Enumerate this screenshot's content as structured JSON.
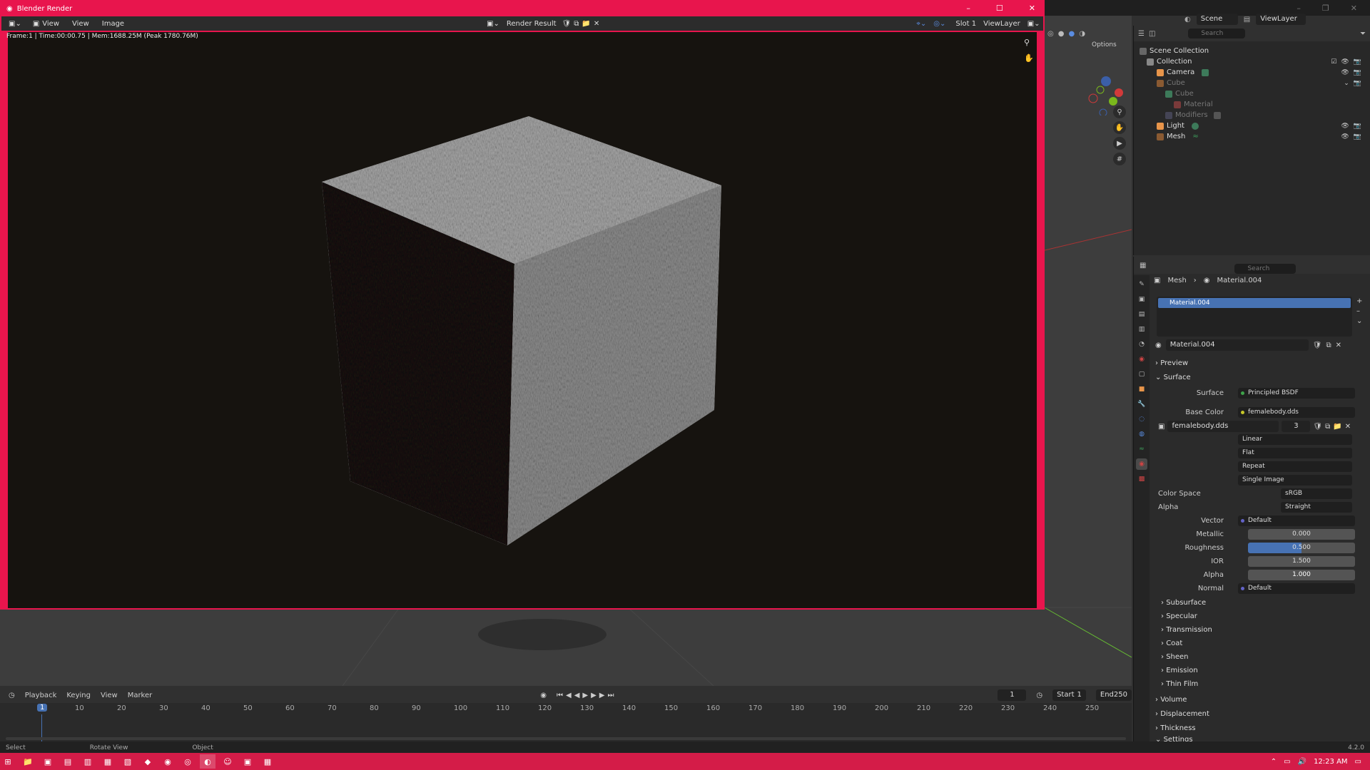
{
  "render_window": {
    "title": "Blender Render",
    "menu": {
      "view": "View",
      "view2": "View",
      "image": "Image"
    },
    "result_label": "Render Result",
    "slot": "Slot 1",
    "view_layer": "ViewLayer",
    "info": "Frame:1 | Time:00:00.75 | Mem:1688.25M (Peak 1780.76M)"
  },
  "scene_bar": {
    "scene": "Scene",
    "view_layer": "ViewLayer"
  },
  "viewport": {
    "options": "Options"
  },
  "outliner": {
    "search_placeholder": "Search",
    "items": [
      {
        "label": "Scene Collection"
      },
      {
        "label": "Collection"
      },
      {
        "label": "Camera"
      },
      {
        "label": "Cube"
      },
      {
        "label": "Cube"
      },
      {
        "label": "Material"
      },
      {
        "label": "Modifiers"
      },
      {
        "label": "Light"
      },
      {
        "label": "Mesh"
      }
    ]
  },
  "properties": {
    "search_placeholder": "Search",
    "breadcrumb_mesh": "Mesh",
    "breadcrumb_material": "Material.004",
    "slot_material": "Material.004",
    "material_name": "Material.004",
    "sections": {
      "preview": "Preview",
      "surface": "Surface"
    },
    "surface_label": "Surface",
    "surface_value": "Principled BSDF",
    "base_color_label": "Base Color",
    "base_color_value": "femalebody.dds",
    "image_name": "femalebody.dds",
    "image_users": "3",
    "interp": "Linear",
    "projection": "Flat",
    "extension": "Repeat",
    "source": "Single Image",
    "color_space_label": "Color Space",
    "color_space_value": "sRGB",
    "alpha_mode_label": "Alpha",
    "alpha_mode_value": "Straight",
    "vector_label": "Vector",
    "vector_value": "Default",
    "metallic_label": "Metallic",
    "metallic_value": "0.000",
    "roughness_label": "Roughness",
    "roughness_value": "0.500",
    "ior_label": "IOR",
    "ior_value": "1.500",
    "alpha_label": "Alpha",
    "alpha_value": "1.000",
    "normal_label": "Normal",
    "normal_value": "Default",
    "subsections": [
      "Subsurface",
      "Specular",
      "Transmission",
      "Coat",
      "Sheen",
      "Emission",
      "Thin Film"
    ],
    "more_sections": [
      "Volume",
      "Displacement",
      "Thickness",
      "Settings"
    ]
  },
  "timeline": {
    "menu": {
      "playback": "Playback",
      "keying": "Keying",
      "view": "View",
      "marker": "Marker"
    },
    "current_frame": "1",
    "start_label": "Start",
    "start": "1",
    "end_label": "End",
    "end": "250",
    "ticks": [
      "10",
      "20",
      "30",
      "40",
      "50",
      "60",
      "70",
      "80",
      "90",
      "100",
      "110",
      "120",
      "130",
      "140",
      "150",
      "160",
      "170",
      "180",
      "190",
      "200",
      "210",
      "220",
      "230",
      "240",
      "250"
    ],
    "playhead": "1"
  },
  "statusbar": {
    "select": "Select",
    "rotate": "Rotate View",
    "object": "Object",
    "version": "4.2.0"
  },
  "taskbar": {
    "time": "12:23 AM"
  },
  "colors": {
    "accent": "#e8154d",
    "blender_blue": "#4772b3",
    "taskbar": "#d41c48"
  }
}
